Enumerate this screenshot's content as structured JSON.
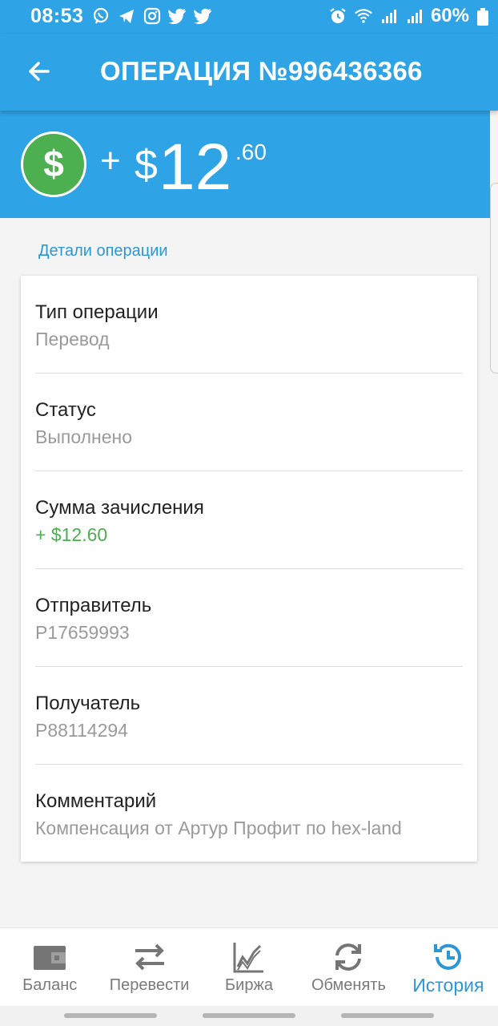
{
  "status_bar": {
    "time": "08:53",
    "battery": "60%",
    "icons_left": [
      "viber-icon",
      "telegram-icon",
      "instagram-icon",
      "twitter-icon",
      "twitter-icon"
    ],
    "icons_right": [
      "alarm-icon",
      "wifi-icon",
      "signal-icon",
      "signal-icon",
      "battery-icon"
    ]
  },
  "app_bar": {
    "title": "ОПЕРАЦИЯ №996436366",
    "back_icon": "arrow-back-icon"
  },
  "amount": {
    "sign": "+",
    "currency": "$",
    "main": "12",
    "cents": ".60",
    "badge_icon": "dollar-icon",
    "badge_color": "#4caf50"
  },
  "section_title": "Детали операции",
  "details": [
    {
      "label": "Тип операции",
      "value": "Перевод"
    },
    {
      "label": "Статус",
      "value": "Выполнено"
    },
    {
      "label": "Сумма зачисления",
      "value": "+ $12.60"
    },
    {
      "label": "Отправитель",
      "value": "P17659993"
    },
    {
      "label": "Получатель",
      "value": "P88114294"
    },
    {
      "label": "Комментарий",
      "value": "Компенсация от Артур Профит по hex-land"
    }
  ],
  "bottom_nav": {
    "items": [
      {
        "label": "Баланс",
        "icon": "wallet-icon"
      },
      {
        "label": "Перевести",
        "icon": "transfer-icon"
      },
      {
        "label": "Биржа",
        "icon": "chart-icon"
      },
      {
        "label": "Обменять",
        "icon": "exchange-icon"
      },
      {
        "label": "История",
        "icon": "history-icon",
        "active": true
      }
    ]
  },
  "colors": {
    "primary": "#2ea3e6",
    "accent_text": "#2b97d6",
    "positive": "#4caf50"
  }
}
